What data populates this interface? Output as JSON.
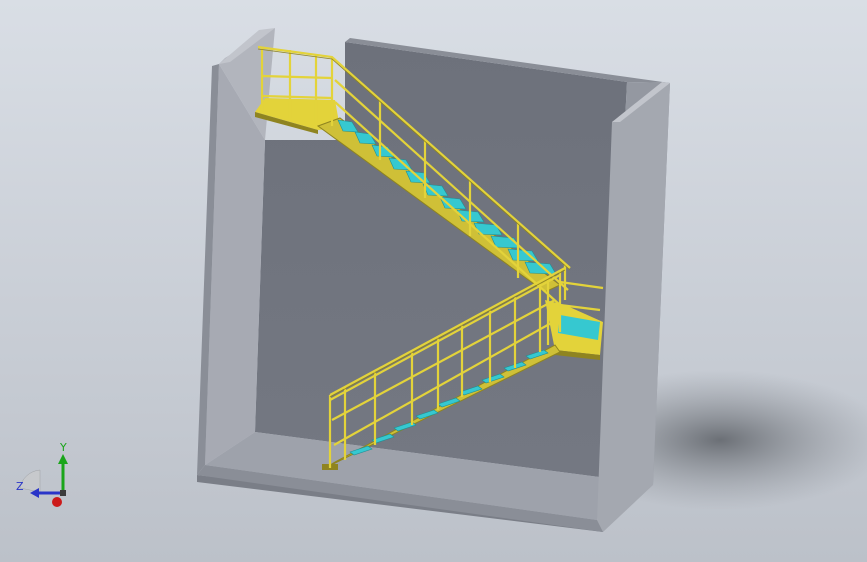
{
  "viewport": {
    "background_top": "#d9dee5",
    "background_bottom": "#bcc1c9"
  },
  "model": {
    "description_icon": "staircase-model",
    "colors": {
      "concrete_face": "#6f737d",
      "concrete_light": "#a7aab3",
      "concrete_side": "#8a8e97",
      "floor": "#9ea2ab",
      "steel_yellow": "#e3d33a",
      "steel_dark": "#8f8420",
      "tread_cyan": "#36c8d0",
      "shadow": "#707479"
    }
  },
  "triad": {
    "x_label": "",
    "y_label": "Y",
    "z_label": "Z",
    "y_color": "#1aa51a",
    "z_color": "#2a35c8",
    "x_color": "#cc1a1a"
  }
}
